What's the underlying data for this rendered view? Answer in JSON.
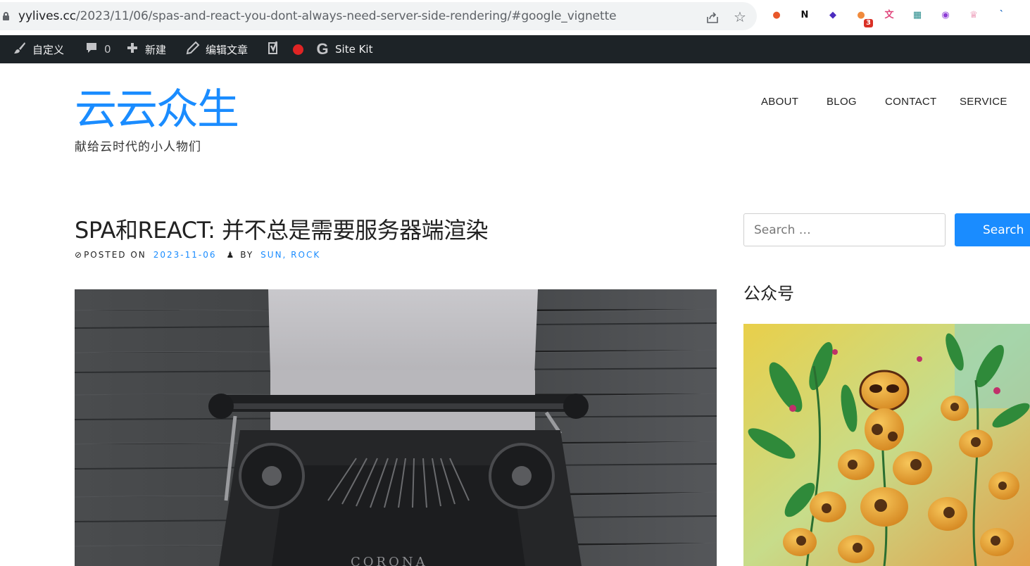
{
  "browser": {
    "url_main": "yylives.cc",
    "url_path": "/2023/11/06/spas-and-react-you-dont-always-need-server-side-rendering/#google_vignette",
    "extensions": [
      {
        "name": "ext-orange-circle-icon",
        "glyph": "●",
        "color": "#e8572a"
      },
      {
        "name": "ext-notion-icon",
        "glyph": "N",
        "color": "#111111"
      },
      {
        "name": "ext-purple-layers-icon",
        "glyph": "◆",
        "color": "#4b2bbf"
      },
      {
        "name": "ext-orange-blob-icon",
        "glyph": "●",
        "color": "#f08a3c",
        "badge": "3"
      },
      {
        "name": "ext-translate-icon",
        "glyph": "文",
        "color": "#e0457b"
      },
      {
        "name": "ext-teal-grid-icon",
        "glyph": "▦",
        "color": "#2a8c8c"
      },
      {
        "name": "ext-purple-circle-icon",
        "glyph": "◉",
        "color": "#8e3fd6"
      },
      {
        "name": "ext-crown-icon",
        "glyph": "♕",
        "color": "#e05a8a"
      },
      {
        "name": "ext-blue-tick-icon",
        "glyph": "ˋ",
        "color": "#1565c0"
      },
      {
        "name": "ext-spiral-icon",
        "glyph": "@",
        "color": "#a06cd5"
      }
    ]
  },
  "admin_bar": {
    "customize": "自定义",
    "comments_count": "0",
    "new": "新建",
    "edit_post": "编辑文章",
    "site_kit": "Site Kit"
  },
  "site": {
    "title": "云云众生",
    "tagline": "献给云时代的小人物们"
  },
  "nav": {
    "items": [
      "ABOUT",
      "BLOG",
      "CONTACT",
      "SERVICE"
    ]
  },
  "post": {
    "title": "SPA和REACT: 并不总是需要服务器端渲染",
    "posted_on_label": "POSTED ON",
    "date": "2023-11-06",
    "by_label": "BY",
    "authors": "SUN, ROCK",
    "image_brand": "CORONA"
  },
  "sidebar": {
    "search_placeholder": "Search …",
    "search_button": "Search",
    "widget_title": "公众号"
  }
}
